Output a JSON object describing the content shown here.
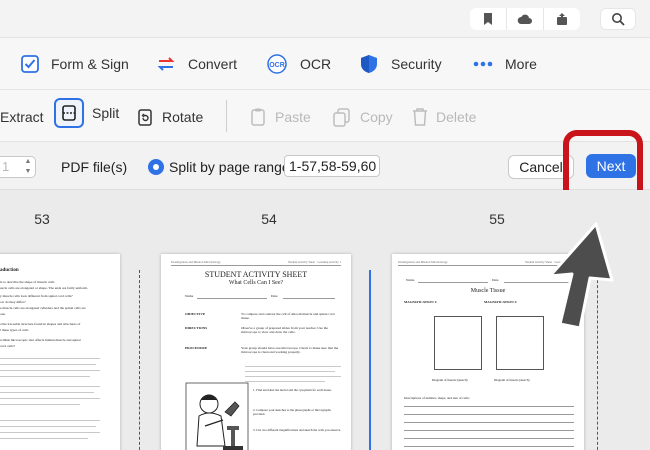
{
  "colors": {
    "accent": "#2f72e6",
    "highlight": "#c8141a",
    "pointer": "#4d4d4d"
  },
  "titlebar": {
    "buttons": [
      {
        "icon": "bookmark-icon"
      },
      {
        "icon": "cloud-icon"
      },
      {
        "icon": "share-icon"
      }
    ],
    "search_icon": "search-icon"
  },
  "toolbar": {
    "items": [
      {
        "label": "Form & Sign",
        "icon": "checkbox-icon"
      },
      {
        "label": "Convert",
        "icon": "convert-icon"
      },
      {
        "label": "OCR",
        "icon": "ocr-icon"
      },
      {
        "label": "Security",
        "icon": "shield-icon"
      },
      {
        "label": "More",
        "icon": "more-dots-icon"
      }
    ]
  },
  "page_tools": {
    "extract": "Extract",
    "split": "Split",
    "rotate": "Rotate",
    "paste": "Paste",
    "copy": "Copy",
    "delete": "Delete"
  },
  "split_bar": {
    "file_count": "1",
    "pdf_files_label": "PDF file(s)",
    "range_option_label": "Split by page range",
    "range_value": "1-57,58-59,60",
    "cancel_label": "Cancel",
    "next_label": "Next"
  },
  "pages": [
    {
      "number": "53",
      "title": "",
      "subtitle": "",
      "lines": [
        "aduction",
        "ls to describe the shape of muscle cells",
        "uscle cells are elongated or shape. The ends are fairly uniform.",
        "y muscle cells look different from spinal cord cells?",
        "ow do they differ?",
        "e muscle cells are elongated cylinders and the spinal cells are",
        "ons.",
        "a the traceable structure found in shapes and structures of",
        "l these types of cells",
        "u think microscopic size affects human muscle and spinal",
        "cord cells?"
      ]
    },
    {
      "number": "54",
      "title": "STUDENT ACTIVITY SHEET",
      "subtitle": "What Cells Can I See?",
      "header_left": "Investigations and Mission Microbiology",
      "header_right": "Student Activity Sheet · Learning Activity 1",
      "name_label": "Name",
      "date_label": "Date",
      "rows": [
        {
          "label": "OBJECTIVE",
          "text": "To compare and contrast the cell of smooth muscle and spinal cord tissue."
        },
        {
          "label": "DIRECTIONS",
          "text": "Observe a group of prepared slides from your teacher. Use the microscope to view and draw the cells."
        },
        {
          "label": "PROCEDURE",
          "text": "Your group should have one microscope. Check to make sure that the microscope is clean and working properly."
        }
      ],
      "steps": [
        "1. Find and label the nuclei and the cytoplasm for each tissue.",
        "2. Compare your sketches to the photographs or micrographs provided.",
        "3. Use two different magnifications and sketch the cells you observe."
      ]
    },
    {
      "number": "55",
      "title": "Muscle Tissue",
      "header_left": "Investigations and Mission Microbiology",
      "header_right": "Student Activity Sheet · Learning Activity 1",
      "name_label": "Name",
      "date_label": "Date",
      "mag1": "MAGNIFICATION 1:",
      "mag2": "MAGNIFICATION 2:",
      "diagram1": "Diagram of muscle (sketch)",
      "diagram2": "Diagram of muscle (sketch)",
      "desc_label": "Descriptions of number, shape, and size of cells:"
    }
  ]
}
